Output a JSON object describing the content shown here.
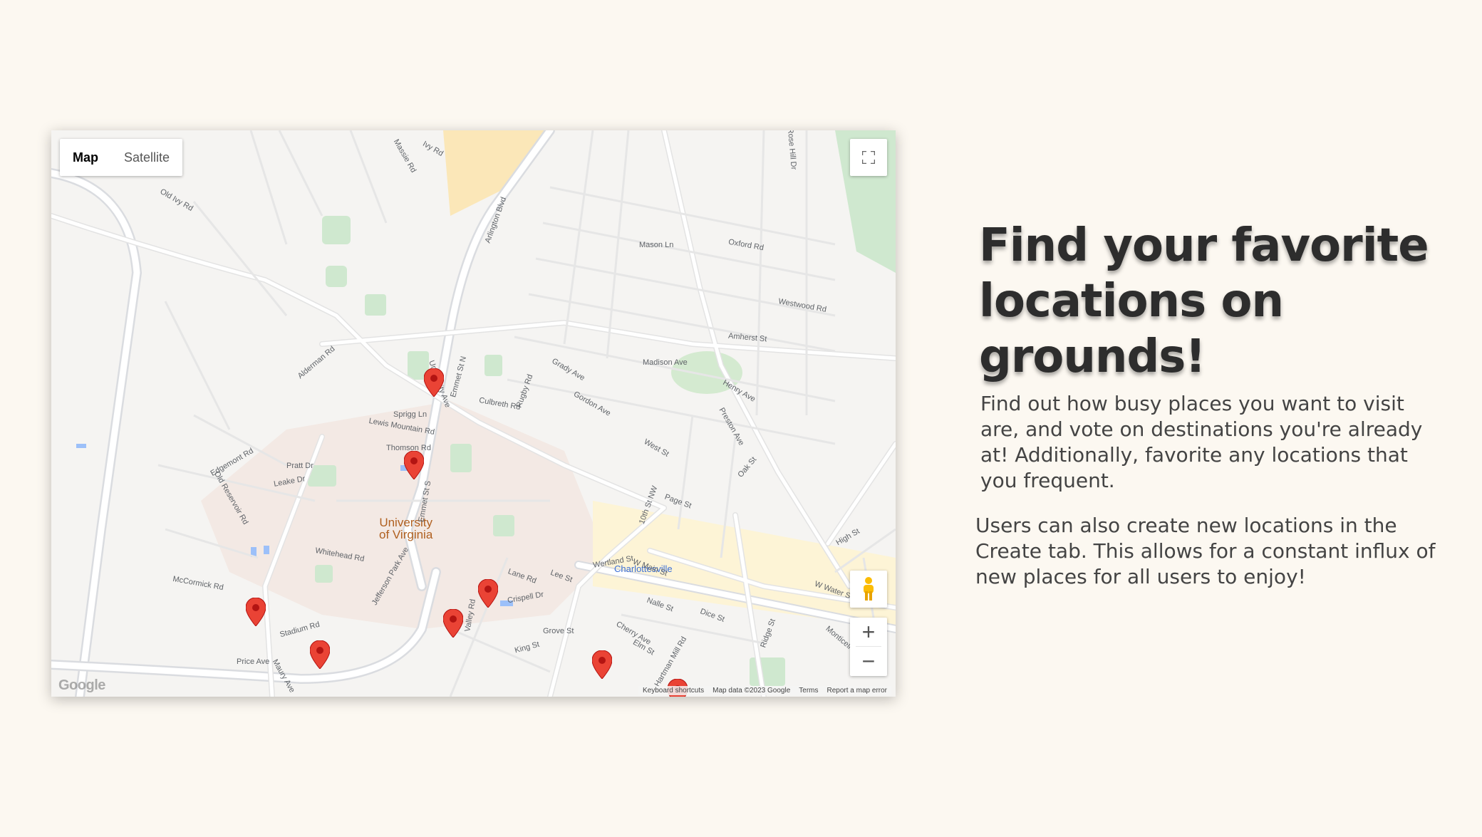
{
  "map": {
    "type_tabs": [
      {
        "label": "Map",
        "active": true
      },
      {
        "label": "Satellite",
        "active": false
      }
    ],
    "poi": "University\nof Virginia",
    "city_label": "Charlottesville",
    "road_labels": [
      "Old Ivy Rd",
      "Ivy Rd",
      "Massie Rd",
      "Arlington Blvd",
      "Emmet St N",
      "Emmet St S",
      "Alderman Rd",
      "Jefferson Park Ave",
      "W Main St",
      "Preston Ave",
      "10th St NW",
      "Cherry Ave",
      "Ridge St",
      "Monticello Ave",
      "Rugby Rd",
      "Grady Ave",
      "Madison Ave",
      "Wertland St",
      "Lewis Mountain Rd",
      "McCormick Rd",
      "Whitehead Rd",
      "Leake Dr",
      "Stadium Rd",
      "Price Ave",
      "Maury Ave",
      "Valley Rd",
      "King St",
      "Grove St",
      "Dice St",
      "Page St",
      "West St",
      "Oak St",
      "High St",
      "W Water St",
      "Rose Hill Dr",
      "Mason Ln",
      "Oxford Rd",
      "Westwood Rd",
      "Amherst St",
      "Henry Ave",
      "Gordon Ave",
      "University Ave",
      "Culbreth Rd",
      "Sprigg Ln",
      "Thomson Rd",
      "Pratt Dr",
      "Edgemont Rd",
      "Old Reservoir Rd",
      "Lee St",
      "Lane Rd",
      "Crispell Dr",
      "Nalle St",
      "Elm St",
      "Hartman Mill Rd"
    ],
    "controls": {
      "zoom_in": "+",
      "zoom_out": "−"
    },
    "logo": "Google",
    "attribution": [
      "Keyboard shortcuts",
      "Map data ©2023 Google",
      "Terms",
      "Report a map error"
    ],
    "marker_color": "#ea4335",
    "marker_count": 8
  },
  "heading": "Find your favorite locations on grounds!",
  "paragraph1": "Find out how busy places you want to visit are, and vote on destinations you're already at! Additionally, favorite any locations that you frequent.",
  "paragraph2": "Users can also create new locations in the Create tab. This allows for a constant influx of new places for all users to enjoy!"
}
